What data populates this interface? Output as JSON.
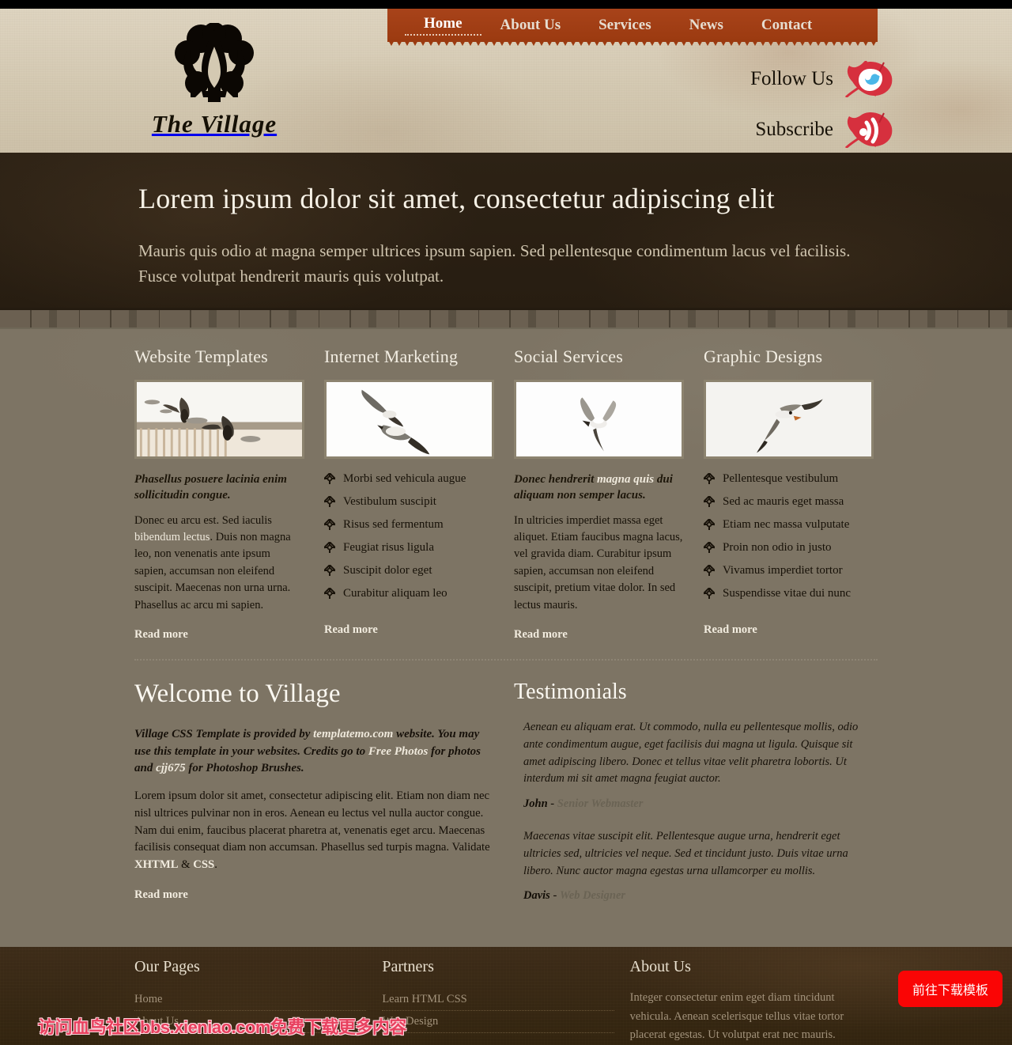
{
  "site": {
    "logo_name": "The Village",
    "logo_icon": "fleur-de-lis-icon"
  },
  "nav": {
    "items": [
      {
        "label": "Home",
        "active": true
      },
      {
        "label": "About Us",
        "active": false
      },
      {
        "label": "Services",
        "active": false
      },
      {
        "label": "News",
        "active": false
      },
      {
        "label": "Contact",
        "active": false
      }
    ]
  },
  "social": {
    "follow": {
      "label": "Follow Us",
      "icon": "twitter-bird-on-leaf-icon"
    },
    "subscribe": {
      "label": "Subscribe",
      "icon": "rss-feed-on-leaf-icon"
    }
  },
  "hero": {
    "title": "Lorem ipsum dolor sit amet, consectetur adipiscing elit",
    "text": "Mauris quis odio at magna semper ultrices ipsum sapien. Sed pellentesque condimentum lacus vel facilisis. Fusce volutpat hendrerit mauris quis volutpat."
  },
  "services": [
    {
      "title": "Website Templates",
      "image_alt": "two-seagulls-over-pier-photo",
      "lead": "Phasellus posuere lacinia enim sollicitudin congue.",
      "body_before": "Donec eu arcu est. Sed iaculis ",
      "body_hl": "bibendum lectus",
      "body_after": ". Duis non magna leo, non venenatis ante ipsum sapien, accumsan non eleifend suscipit. Maecenas non urna urna. Phasellus ac arcu mi sapien.",
      "read_more": "Read more"
    },
    {
      "title": "Internet Marketing",
      "image_alt": "two-flying-seagulls-photo",
      "list": [
        "Morbi sed vehicula augue",
        "Vestibulum suscipit",
        "Risus sed fermentum",
        "Feugiat risus ligula",
        "Suscipit dolor eget",
        "Curabitur aliquam leo"
      ],
      "read_more": "Read more"
    },
    {
      "title": "Social Services",
      "image_alt": "single-flying-seagull-photo",
      "lead_before": "Donec hendrerit ",
      "lead_hl": "magna quis",
      "lead_after": " dui aliquam non semper lacus.",
      "body": "In ultricies imperdiet massa eget aliquet. Etiam faucibus magna lacus, vel gravida diam. Curabitur ipsum sapien, accumsan non eleifend suscipit, pretium vitae dolor. In sed lectus mauris.",
      "read_more": "Read more"
    },
    {
      "title": "Graphic Designs",
      "image_alt": "seagull-in-flight-photo",
      "list": [
        "Pellentesque vestibulum",
        "Sed ac mauris eget massa",
        "Etiam nec massa vulputate",
        "Proin non odio in justo",
        "Vivamus imperdiet tortor",
        "Suspendisse vitae dui nunc"
      ],
      "read_more": "Read more"
    }
  ],
  "welcome": {
    "title": "Welcome to Village",
    "intro_1": "Village CSS Template is provided by ",
    "intro_link_1": "templatemo.com",
    "intro_2": " website. You may use this template in your websites. Credits go to ",
    "intro_link_2": "Free Photos",
    "intro_3": " for photos and ",
    "intro_link_3": "cjj675",
    "intro_4": " for Photoshop Brushes.",
    "para_1": "Lorem ipsum dolor sit amet, consectetur adipiscing elit. Etiam non diam nec nisl ultrices pulvinar non in eros. Aenean eu lectus vel nulla auctor congue. Nam dui enim, faucibus placerat pharetra at, venenatis eget arcu. Maecenas facilisis consequat diam non accumsan. Phasellus sed turpis magna. Validate ",
    "para_link_1": "XHTML",
    "para_amp": " & ",
    "para_link_2": "CSS",
    "para_end": ".",
    "read_more": "Read more"
  },
  "testimonials": {
    "title": "Testimonials",
    "items": [
      {
        "quote": "Aenean eu aliquam erat. Ut commodo, nulla eu pellentesque mollis, odio ante condimentum augue, eget facilisis dui magna ut ligula. Quisque sit amet adipiscing libero. Donec et tellus vitae velit pharetra lobortis. Ut interdum mi sit amet magna feugiat auctor.",
        "author": "John",
        "sep": " - ",
        "role": "Senior Webmaster"
      },
      {
        "quote": "Maecenas vitae suscipit elit. Pellentesque augue urna, hendrerit eget ultricies sed, ultricies vel neque. Sed et tincidunt justo. Duis vitae urna libero. Nunc auctor magna egestas urna ullamcorper eu mollis.",
        "author": "Davis",
        "sep": " - ",
        "role": "Web Designer"
      }
    ]
  },
  "footer": {
    "our_pages": {
      "title": "Our Pages",
      "items": [
        "Home",
        "About Us"
      ]
    },
    "partners": {
      "title": "Partners",
      "items": [
        "Learn HTML CSS",
        "Web Design"
      ]
    },
    "about": {
      "title": "About Us",
      "text": "Integer consectetur enim eget diam tincidunt vehicula. Aenean scelerisque tellus vitae tortor placerat egestas. Ut volutpat erat nec mauris."
    }
  },
  "overlay": {
    "download_button": "前往下载模板",
    "watermark": "访问血鸟社区bbs.xieniao.com免费下载更多内容"
  },
  "colors": {
    "nav_bg": "#9b3a10",
    "hero_bg": "#2a2014",
    "content_bg": "#7d7464",
    "footer_bg": "#3a2a18",
    "download_red": "#fa0505",
    "watermark_pink": "#e8415f"
  }
}
